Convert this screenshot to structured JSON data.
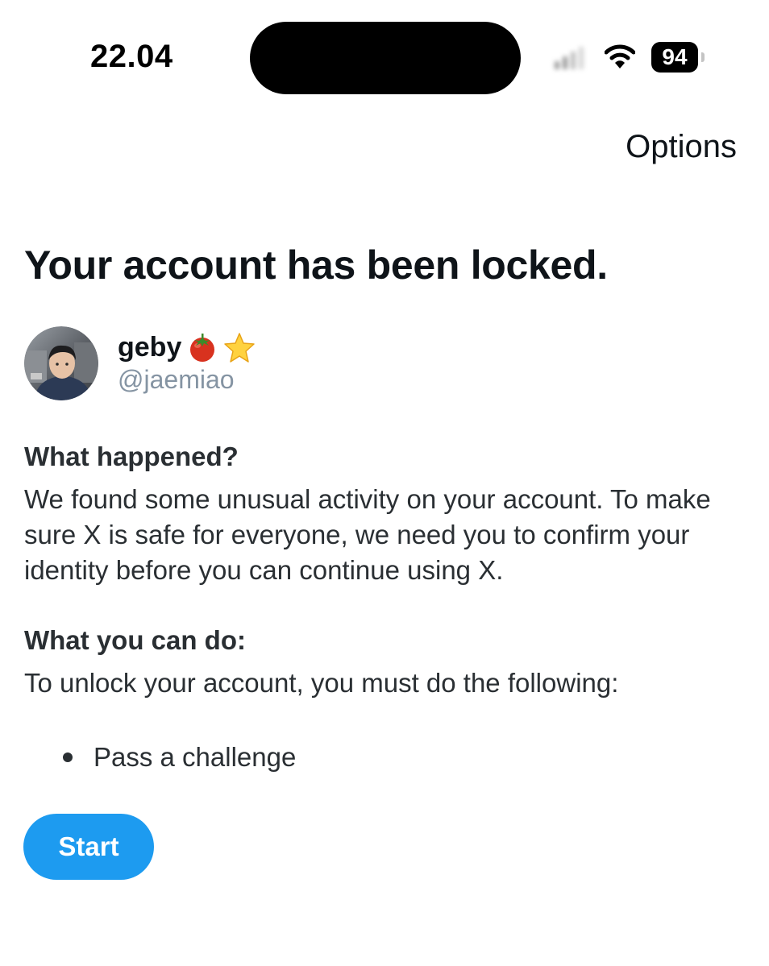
{
  "status_bar": {
    "time": "22.04",
    "battery_level": "94",
    "icons": [
      "signal-icon",
      "wifi-icon",
      "battery-icon"
    ]
  },
  "header": {
    "options_label": "Options"
  },
  "main": {
    "title": "Your account has been locked.",
    "profile": {
      "display_name": "geby",
      "name_emojis": [
        "tomato-icon",
        "star-icon"
      ],
      "handle": "@jaemiao"
    },
    "what_happened": {
      "heading": "What happened?",
      "body": "We found some unusual activity on your account. To make sure X is safe for everyone, we need you to confirm your identity before you can continue using X."
    },
    "what_you_can_do": {
      "heading": "What you can do:",
      "body": "To unlock your account, you must do the following:",
      "steps": [
        "Pass a challenge"
      ]
    },
    "start_label": "Start"
  },
  "colors": {
    "accent": "#1d9bf0",
    "text": "#0f1419",
    "muted": "#8594a3"
  }
}
